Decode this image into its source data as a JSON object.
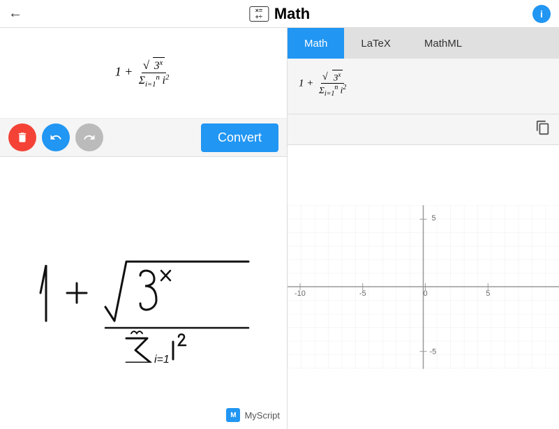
{
  "header": {
    "title": "Math",
    "icon_label": "×=",
    "back_aria": "Back",
    "info_aria": "Info",
    "icon_alt": "math-formula-icon"
  },
  "toolbar": {
    "delete_label": "Delete",
    "undo_label": "Undo",
    "redo_label": "Redo",
    "convert_label": "Convert"
  },
  "tabs": [
    {
      "id": "math",
      "label": "Math",
      "active": true
    },
    {
      "id": "latex",
      "label": "LaTeX",
      "active": false
    },
    {
      "id": "mathml",
      "label": "MathML",
      "active": false
    }
  ],
  "myscript": {
    "watermark": "MyScript"
  },
  "graph": {
    "x_labels": [
      "-10",
      "-5",
      "0",
      "5"
    ],
    "y_labels": [
      "5",
      "-5"
    ],
    "accent_color": "#2196F3"
  },
  "copy_btn_label": "Copy"
}
